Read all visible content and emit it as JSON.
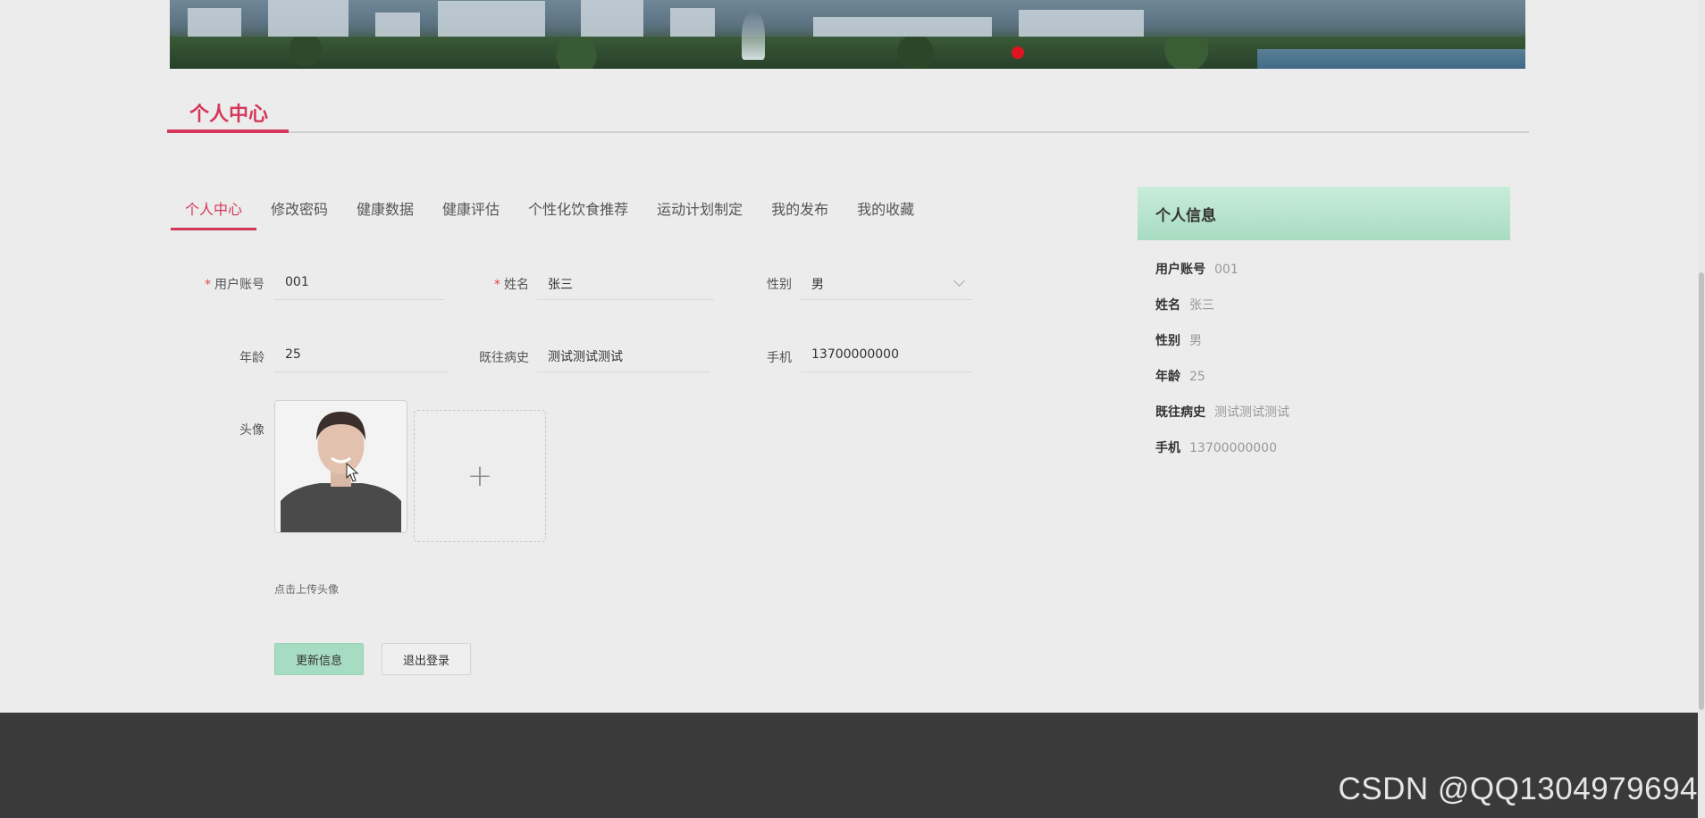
{
  "section_title": "个人中心",
  "tabs": [
    {
      "label": "个人中心",
      "active": true
    },
    {
      "label": "修改密码"
    },
    {
      "label": "健康数据"
    },
    {
      "label": "健康评估"
    },
    {
      "label": "个性化饮食推荐"
    },
    {
      "label": "运动计划制定"
    },
    {
      "label": "我的发布"
    },
    {
      "label": "我的收藏"
    }
  ],
  "form": {
    "account_label": "用户账号",
    "account_value": "001",
    "name_label": "姓名",
    "name_value": "张三",
    "gender_label": "性别",
    "gender_value": "男",
    "age_label": "年龄",
    "age_value": "25",
    "history_label": "既往病史",
    "history_value": "测试测试测试",
    "phone_label": "手机",
    "phone_value": "13700000000",
    "avatar_label": "头像",
    "upload_hint": "点击上传头像",
    "update_button": "更新信息",
    "logout_button": "退出登录",
    "required_mark": "*"
  },
  "info_panel": {
    "title": "个人信息",
    "rows": [
      {
        "label": "用户账号",
        "value": "001"
      },
      {
        "label": "姓名",
        "value": "张三"
      },
      {
        "label": "性别",
        "value": "男"
      },
      {
        "label": "年龄",
        "value": "25"
      },
      {
        "label": "既往病史",
        "value": "测试测试测试"
      },
      {
        "label": "手机",
        "value": "13700000000"
      }
    ]
  },
  "watermark": "CSDN @QQ1304979694",
  "colors": {
    "accent": "#d4375a",
    "panel_green": "#a9dcc2",
    "footer": "#3a3a3a"
  }
}
